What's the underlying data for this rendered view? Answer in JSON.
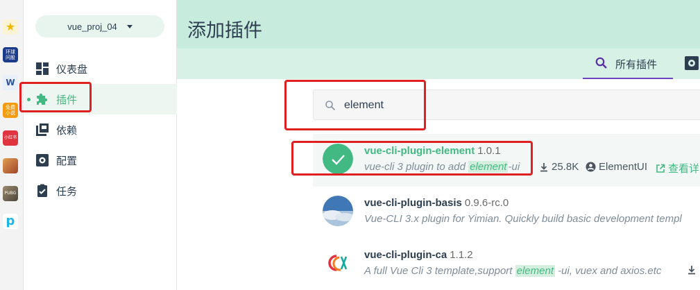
{
  "dock": {
    "items": [
      {
        "name": "star-app",
        "text": "★",
        "color": "#f7c945"
      },
      {
        "name": "app-2",
        "text": "环球\n问股",
        "color": "#1b3b8a"
      },
      {
        "name": "word-app",
        "text": "W",
        "color": "#2b579a"
      },
      {
        "name": "novel-app",
        "text": "免费\n小说",
        "color": "#f39c12"
      },
      {
        "name": "xiaohongshu-app",
        "text": "小红书",
        "color": "#e03440"
      },
      {
        "name": "game-app-1",
        "text": "",
        "color": "#c8702a"
      },
      {
        "name": "game-app-2",
        "text": "PUBG",
        "color": "#6c6253"
      },
      {
        "name": "app-p",
        "text": "p",
        "color": "#ffffff"
      }
    ]
  },
  "sidebar": {
    "project": "vue_proj_04",
    "items": [
      {
        "label": "仪表盘",
        "icon": "dashboard-icon"
      },
      {
        "label": "插件",
        "icon": "puzzle-icon",
        "active": true
      },
      {
        "label": "依赖",
        "icon": "library-icon"
      },
      {
        "label": "配置",
        "icon": "gear-icon"
      },
      {
        "label": "任务",
        "icon": "task-icon"
      }
    ]
  },
  "main": {
    "title": "添加插件",
    "tab_all": "所有插件",
    "search_value": "element"
  },
  "results": [
    {
      "name_prefix": "vue-cli-plugin-",
      "name_highlight": "element",
      "version": "1.0.1",
      "desc_before": "vue-cli 3 plugin to add ",
      "desc_mark": "element",
      "desc_after": "-ui",
      "downloads": "25.8K",
      "author": "ElementUI",
      "link": "查看详"
    },
    {
      "name": "vue-cli-plugin-basis",
      "version": "0.9.6-rc.0",
      "desc": "Vue-CLI 3.x plugin for Yimian. Quickly build basic development templ"
    },
    {
      "name": "vue-cli-plugin-ca",
      "version": "1.1.2",
      "desc_before": "A full Vue Cli 3 template,support ",
      "desc_mark": "element",
      "desc_after": " -ui, vuex and axios.etc"
    }
  ],
  "colors": {
    "accent": "#42b983",
    "header": "#c7ebdc",
    "tabbar": "#d8f1e6",
    "annotation": "#e02020",
    "tab_indicator": "#6f42c1"
  }
}
